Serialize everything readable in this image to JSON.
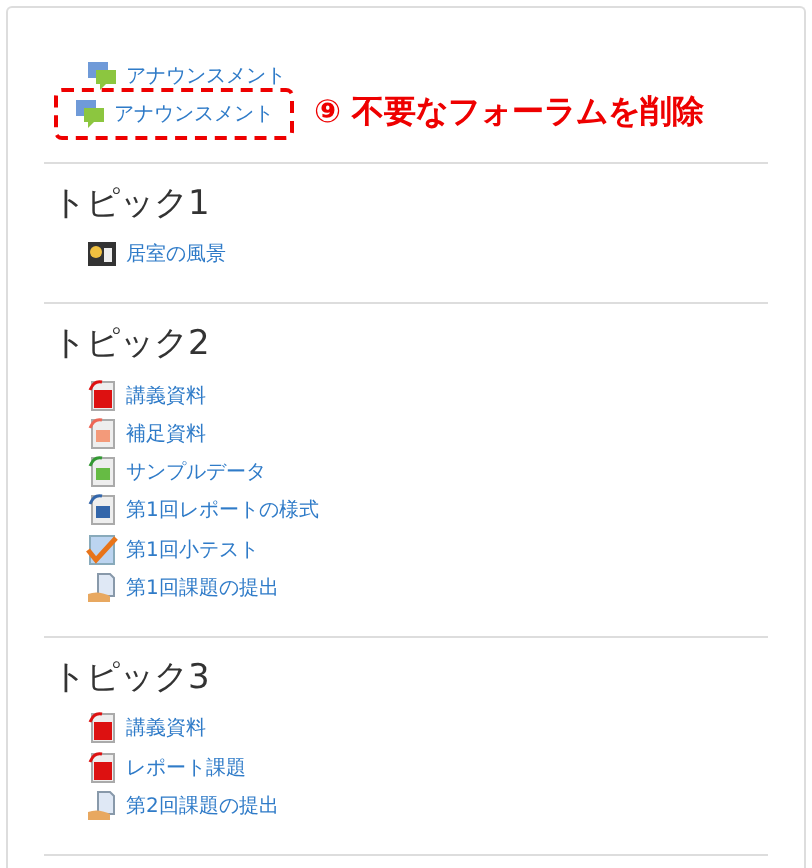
{
  "sections": [
    {
      "items": [
        {
          "label": "アナウンスメント",
          "kind": "forum",
          "highlighted": false
        },
        {
          "label": "アナウンスメント",
          "kind": "forum",
          "highlighted": true,
          "annotation": "⑨ 不要なフォーラムを削除"
        }
      ]
    },
    {
      "title": "トピック1",
      "items": [
        {
          "label": "居室の風景",
          "kind": "video",
          "highlighted": false
        }
      ]
    },
    {
      "title": "トピック2",
      "items": [
        {
          "label": "講義資料",
          "kind": "pdf",
          "highlighted": false
        },
        {
          "label": "補足資料",
          "kind": "image",
          "highlighted": false
        },
        {
          "label": "サンプルデータ",
          "kind": "spreadsheet",
          "highlighted": false
        },
        {
          "label": "第1回レポートの様式",
          "kind": "document",
          "highlighted": false
        },
        {
          "label": "第1回小テスト",
          "kind": "quiz",
          "highlighted": false
        },
        {
          "label": "第1回課題の提出",
          "kind": "assignment",
          "highlighted": false
        }
      ]
    },
    {
      "title": "トピック3",
      "items": [
        {
          "label": "講義資料",
          "kind": "pdf",
          "highlighted": false
        },
        {
          "label": "レポート課題",
          "kind": "pdf",
          "highlighted": false
        },
        {
          "label": "第2回課題の提出",
          "kind": "assignment",
          "highlighted": false
        }
      ]
    }
  ]
}
